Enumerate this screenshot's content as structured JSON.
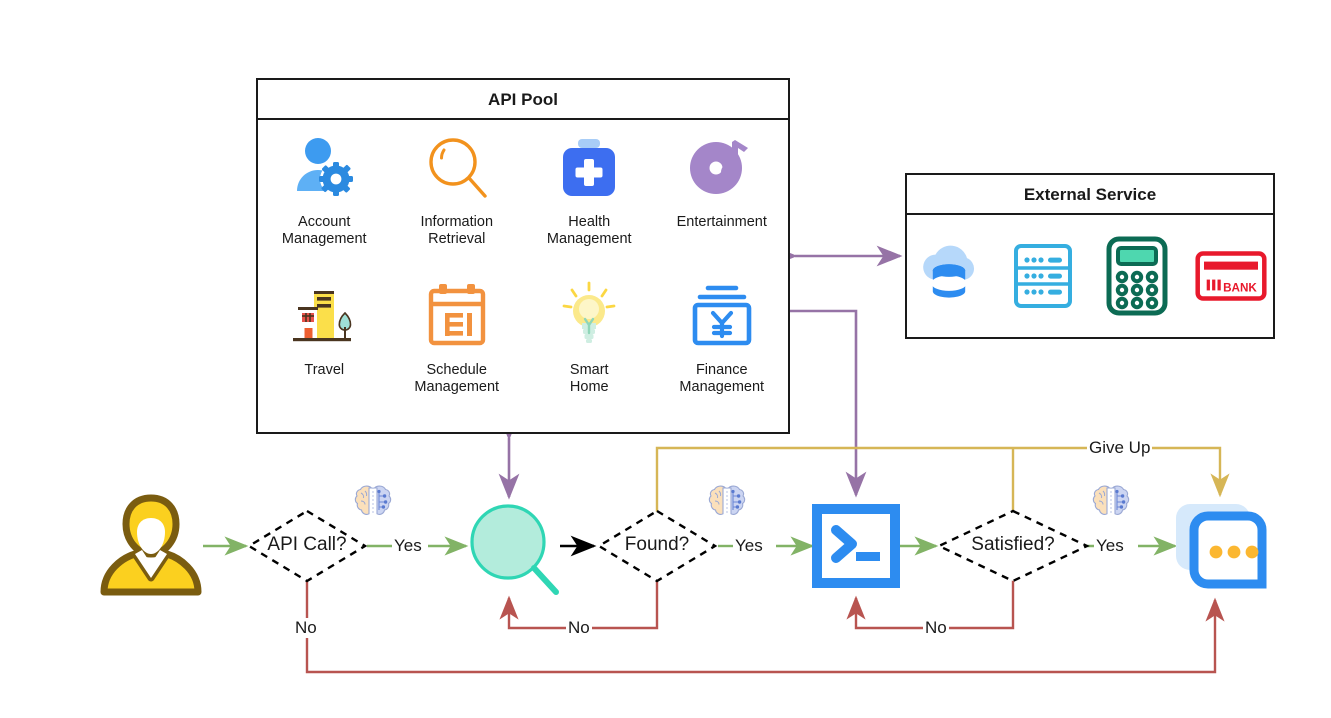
{
  "panels": {
    "api_pool": {
      "title": "API Pool",
      "items": [
        {
          "label": "Account\nManagement",
          "icon": "account-management-icon"
        },
        {
          "label": "Information\nRetrieval",
          "icon": "information-retrieval-icon"
        },
        {
          "label": "Health\nManagement",
          "icon": "health-management-icon"
        },
        {
          "label": "Entertainment",
          "icon": "entertainment-icon"
        },
        {
          "label": "Travel",
          "icon": "travel-icon"
        },
        {
          "label": "Schedule\nManagement",
          "icon": "schedule-management-icon"
        },
        {
          "label": "Smart\nHome",
          "icon": "smart-home-icon"
        },
        {
          "label": "Finance\nManagement",
          "icon": "finance-management-icon"
        }
      ]
    },
    "external_service": {
      "title": "External Service",
      "items": [
        {
          "icon": "cloud-database-icon",
          "label": ""
        },
        {
          "icon": "server-rack-icon",
          "label": ""
        },
        {
          "icon": "calculator-icon",
          "label": ""
        },
        {
          "icon": "bank-card-icon",
          "label": "BANK"
        }
      ]
    }
  },
  "flow": {
    "nodes": [
      {
        "id": "user",
        "icon": "user-avatar-icon",
        "label": ""
      },
      {
        "id": "api_call",
        "shape": "decision",
        "label": "API Call?"
      },
      {
        "id": "retriever",
        "icon": "magnifier-icon",
        "label": ""
      },
      {
        "id": "found",
        "shape": "decision",
        "label": "Found?"
      },
      {
        "id": "terminal",
        "icon": "terminal-icon",
        "label": ""
      },
      {
        "id": "satisfied",
        "shape": "decision",
        "label": "Satisfied?"
      },
      {
        "id": "response",
        "icon": "chat-bubble-icon",
        "label": ""
      }
    ],
    "edge_labels": {
      "yes1": "Yes",
      "yes2": "Yes",
      "yes3": "Yes",
      "no_api_call": "No",
      "no_found": "No",
      "no_satisfied": "No",
      "give_up": "Give Up"
    },
    "llm_badges": [
      "brain-icon",
      "brain-icon",
      "brain-icon"
    ]
  },
  "colors": {
    "green_flow": "#82b366",
    "red_flow": "#b85450",
    "yellow_flow": "#d6b656",
    "purple_flow": "#9673a6",
    "black_flow": "#000000",
    "panel_border": "#1a1a1a",
    "accent_blue": "#2d8cf0",
    "accent_orange": "#f08a3c",
    "accent_teal": "#2fd6b4",
    "accent_yellow": "#fbd01f"
  }
}
